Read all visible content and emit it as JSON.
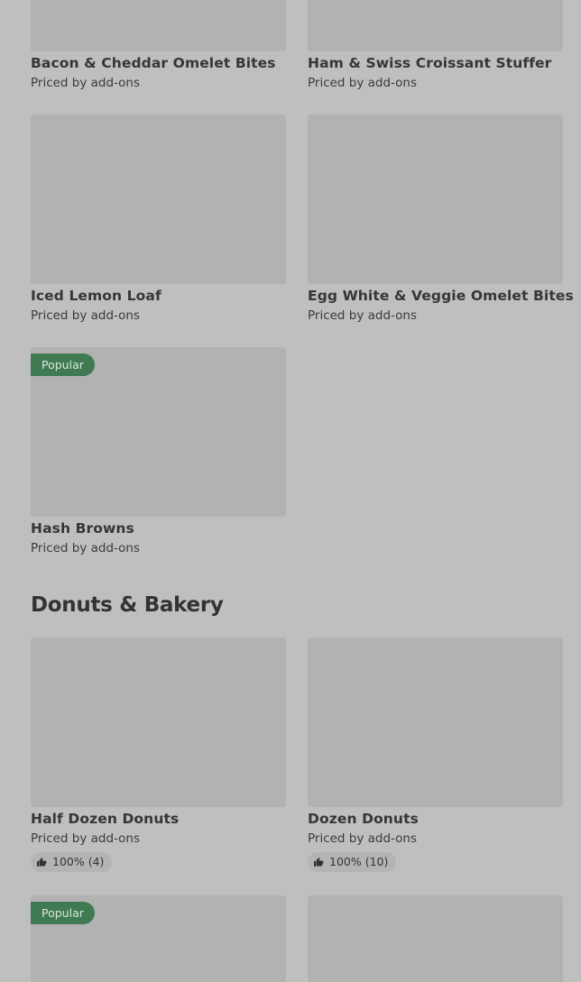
{
  "items_top": [
    {
      "title": "Bacon & Cheddar Omelet Bites",
      "price": "Priced by add-ons"
    },
    {
      "title": "Ham & Swiss Croissant Stuffer",
      "price": "Priced by add-ons"
    },
    {
      "title": "Iced Lemon Loaf",
      "price": "Priced by add-ons"
    },
    {
      "title": "Egg White & Veggie Omelet Bites",
      "price": "Priced by add-ons"
    },
    {
      "title": "Hash Browns",
      "price": "Priced by add-ons",
      "badge": "Popular"
    }
  ],
  "section": {
    "title": "Donuts & Bakery"
  },
  "items_donuts": [
    {
      "title": "Half Dozen Donuts",
      "price": "Priced by add-ons",
      "rating": "100% (4)"
    },
    {
      "title": "Dozen Donuts",
      "price": "Priced by add-ons",
      "rating": "100% (10)"
    },
    {
      "badge": "Popular"
    }
  ],
  "icons": {
    "rating": "thumbs-up-icon"
  },
  "colors": {
    "background": "#bfbfbf",
    "image_placeholder": "#b2b2b2",
    "popular_badge": "#3f7a53"
  }
}
